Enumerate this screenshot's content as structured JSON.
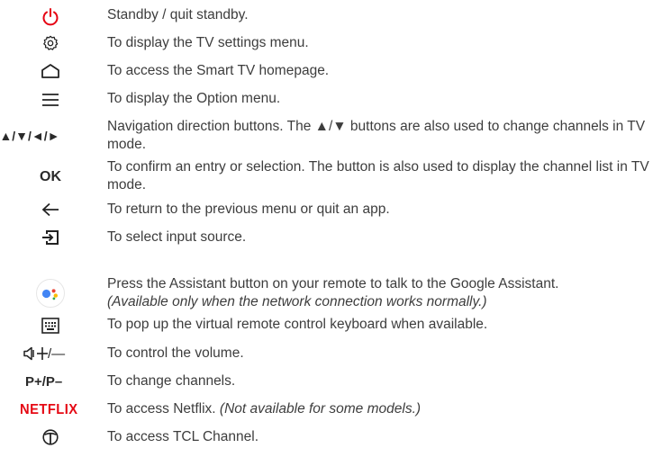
{
  "entries": [
    {
      "icon": "power-icon",
      "text": "Standby / quit standby."
    },
    {
      "icon": "settings-gear-icon",
      "text": "To display the TV settings menu."
    },
    {
      "icon": "home-icon",
      "text": "To access the Smart TV homepage."
    },
    {
      "icon": "option-menu-icon",
      "text": "To display the Option menu."
    },
    {
      "icon": "navigation-arrows-icon",
      "label": "▲/▼/◄/►",
      "text": "Navigation direction buttons. The ▲/▼ buttons are also used to change channels in TV mode."
    },
    {
      "icon": "ok-button-icon",
      "label": "OK",
      "text": "To confirm an entry or selection. The button is also used to display the channel list in TV mode."
    },
    {
      "icon": "back-arrow-icon",
      "text": "To return to the previous menu or quit an app."
    },
    {
      "icon": "input-source-icon",
      "text": "To select input source."
    },
    {
      "icon": "google-assistant-icon",
      "text": "Press the Assistant button on your remote to talk to the Google Assistant.",
      "note": "(Available only when the network connection works normally.)"
    },
    {
      "icon": "keyboard-icon",
      "text": "To pop up the virtual remote control keyboard when available."
    },
    {
      "icon": "volume-icon",
      "label": "/—",
      "text": "To control the volume."
    },
    {
      "icon": "channel-icon",
      "label": "P+/P–",
      "text": "To change channels."
    },
    {
      "icon": "netflix-logo-icon",
      "label": "NETFLIX",
      "text": "To access Netflix.",
      "note": "(Not available for some models.)"
    },
    {
      "icon": "tcl-channel-icon",
      "text": "To access TCL Channel."
    }
  ],
  "colors": {
    "power": "#e60012",
    "netflix": "#e50914",
    "text": "#3d3d3d",
    "assistant_blue": "#4285f4",
    "assistant_red": "#ea4335",
    "assistant_yellow": "#fbbc05",
    "assistant_green": "#34a853"
  }
}
